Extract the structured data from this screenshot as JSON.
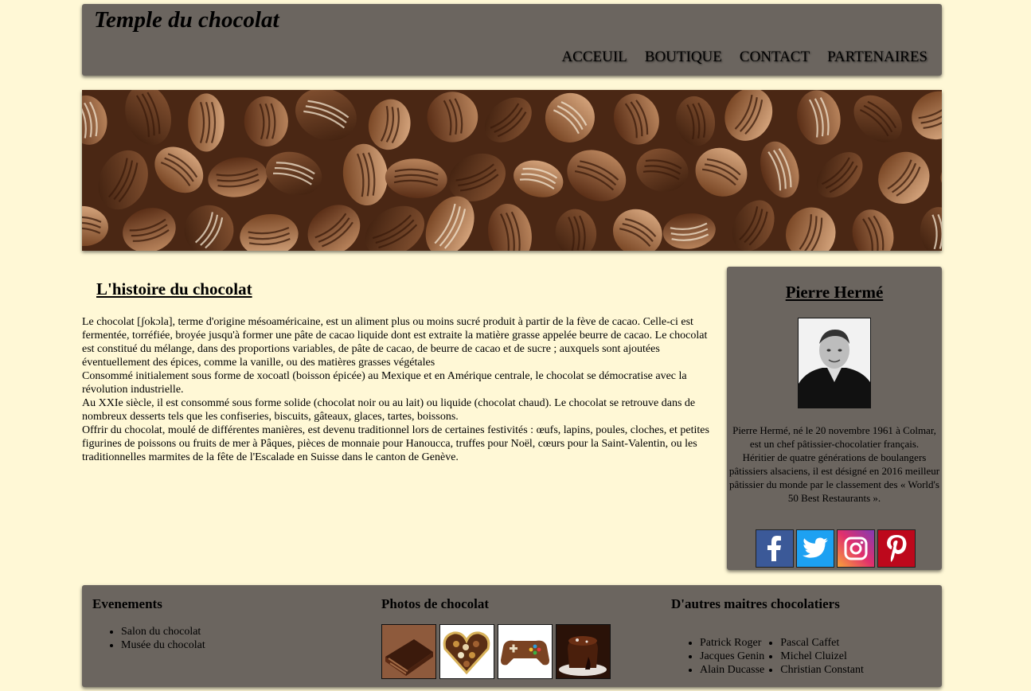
{
  "header": {
    "title": "Temple du chocolat",
    "nav": [
      "ACCEUIL",
      "BOUTIQUE",
      "CONTACT",
      "PARTENAIRES"
    ]
  },
  "article": {
    "title": "L'histoire du chocolat",
    "paragraphs": [
      "Le chocolat [ʃokɔla], terme d'origine mésoaméricaine, est un aliment plus ou moins sucré produit à partir de la fève de cacao. Celle-ci est fermentée, torréfiée, broyée jusqu'à former une pâte de cacao liquide dont est extraite la matière grasse appelée beurre de cacao. Le chocolat est constitué du mélange, dans des proportions variables, de pâte de cacao, de beurre de cacao et de sucre ; auxquels sont ajoutées éventuellement des épices, comme la vanille, ou des matières grasses végétales",
      "Consommé initialement sous forme de xocoatl (boisson épicée) au Mexique et en Amérique centrale, le chocolat se démocratise avec la révolution industrielle.",
      "Au XXIe siècle, il est consommé sous forme solide (chocolat noir ou au lait) ou liquide (chocolat chaud). Le chocolat se retrouve dans de nombreux desserts tels que les confiseries, biscuits, gâteaux, glaces, tartes, boissons.",
      "Offrir du chocolat, moulé de différentes manières, est devenu traditionnel lors de certaines festivités : œufs, lapins, poules, cloches, et petites figurines de poissons ou fruits de mer à Pâques, pièces de monnaie pour Hanoucca, truffes pour Noël, cœurs pour la Saint-Valentin, ou les traditionnelles marmites de la fête de l'Escalade en Suisse dans le canton de Genève."
    ]
  },
  "sidebar": {
    "title": "Pierre Hermé",
    "bio": [
      "Pierre Hermé, né le 20 novembre 1961 à Colmar, est un chef pâtissier-chocolatier français.",
      "Héritier de quatre générations de boulangers pâtissiers alsaciens, il est désigné en 2016 meilleur pâtissier du monde par le classement des « World's 50 Best Restaurants »."
    ],
    "social": [
      {
        "icon": "facebook-icon",
        "color": "#3b5998"
      },
      {
        "icon": "twitter-icon",
        "color": "#1da1f2"
      },
      {
        "icon": "instagram-icon",
        "color": "#c13584"
      },
      {
        "icon": "pinterest-icon",
        "color": "#bd081c"
      }
    ]
  },
  "footer": {
    "events": {
      "title": "Evenements",
      "items": [
        "Salon du chocolat",
        "Musée du chocolat"
      ]
    },
    "photos": {
      "title": "Photos de chocolat"
    },
    "masters": {
      "title": "D'autres maitres chocolatiers",
      "left": [
        "Patrick Roger",
        "Jacques Genin",
        "Alain Ducasse"
      ],
      "right": [
        "Pascal Caffet",
        "Michel Cluizel",
        "Christian Constant"
      ]
    }
  },
  "colors": {
    "page_background": "#fff8d6",
    "panel": "#6b655f"
  }
}
